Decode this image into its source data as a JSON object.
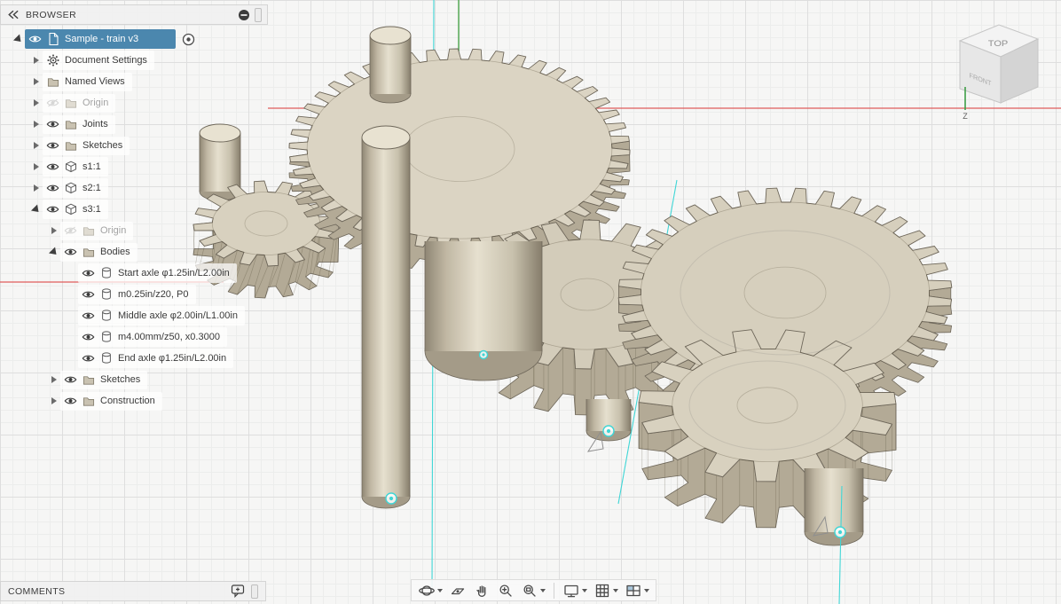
{
  "browser": {
    "title": "BROWSER",
    "tree": [
      {
        "label": "Sample - train v3",
        "level": 0,
        "arrow": "expanded",
        "eye": "visible",
        "icon": "component-root",
        "selected": true,
        "radio": true
      },
      {
        "label": "Document Settings",
        "level": 1,
        "arrow": "collapsed",
        "eye": "none",
        "icon": "gear"
      },
      {
        "label": "Named Views",
        "level": 1,
        "arrow": "collapsed",
        "eye": "none",
        "icon": "folder"
      },
      {
        "label": "Origin",
        "level": 1,
        "arrow": "collapsed",
        "eye": "hidden",
        "icon": "folder"
      },
      {
        "label": "Joints",
        "level": 1,
        "arrow": "collapsed",
        "eye": "visible",
        "icon": "folder"
      },
      {
        "label": "Sketches",
        "level": 1,
        "arrow": "collapsed",
        "eye": "visible",
        "icon": "folder"
      },
      {
        "label": "s1:1",
        "level": 1,
        "arrow": "collapsed",
        "eye": "visible",
        "icon": "component"
      },
      {
        "label": "s2:1",
        "level": 1,
        "arrow": "collapsed",
        "eye": "visible",
        "icon": "component"
      },
      {
        "label": "s3:1",
        "level": 1,
        "arrow": "expanded",
        "eye": "visible",
        "icon": "component"
      },
      {
        "label": "Origin",
        "level": 2,
        "arrow": "collapsed",
        "eye": "hidden",
        "icon": "folder"
      },
      {
        "label": "Bodies",
        "level": 2,
        "arrow": "expanded",
        "eye": "visible",
        "icon": "folder"
      },
      {
        "label": "Start axle φ1.25in/L2.00in",
        "level": 3,
        "arrow": "none",
        "eye": "visible",
        "icon": "body"
      },
      {
        "label": "m0.25in/z20, P0",
        "level": 3,
        "arrow": "none",
        "eye": "visible",
        "icon": "body"
      },
      {
        "label": "Middle axle φ2.00in/L1.00in",
        "level": 3,
        "arrow": "none",
        "eye": "visible",
        "icon": "body"
      },
      {
        "label": "m4.00mm/z50, x0.3000",
        "level": 3,
        "arrow": "none",
        "eye": "visible",
        "icon": "body"
      },
      {
        "label": "End axle φ1.25in/L2.00in",
        "level": 3,
        "arrow": "none",
        "eye": "visible",
        "icon": "body"
      },
      {
        "label": "Sketches",
        "level": 2,
        "arrow": "collapsed",
        "eye": "visible",
        "icon": "folder"
      },
      {
        "label": "Construction",
        "level": 2,
        "arrow": "collapsed",
        "eye": "visible",
        "icon": "folder"
      }
    ]
  },
  "comments": {
    "title": "COMMENTS"
  },
  "viewcube": {
    "top_label": "TOP",
    "front_label": "FRONT",
    "axis_label": "Z"
  },
  "nav_toolbar": {
    "tools": [
      {
        "name": "orbit",
        "dropdown": true
      },
      {
        "name": "look-at",
        "dropdown": false
      },
      {
        "name": "pan",
        "dropdown": false
      },
      {
        "name": "zoom",
        "dropdown": false
      },
      {
        "name": "fit",
        "dropdown": true
      },
      {
        "name": "display-settings",
        "dropdown": true
      },
      {
        "name": "grid-and-snaps",
        "dropdown": true
      },
      {
        "name": "viewports",
        "dropdown": true
      }
    ]
  },
  "colors": {
    "selection_blue": "#4b87ae",
    "gear_top": "#d8d1bf",
    "gear_side": "#b3aa96",
    "gear_bottom": "#a49b88",
    "cyl_top": "#e8e2d1",
    "outline": "#6e675a",
    "axis_red": "#e05c5c",
    "axis_green": "#4aa34a",
    "construction_cyan": "#3fd6d6"
  }
}
